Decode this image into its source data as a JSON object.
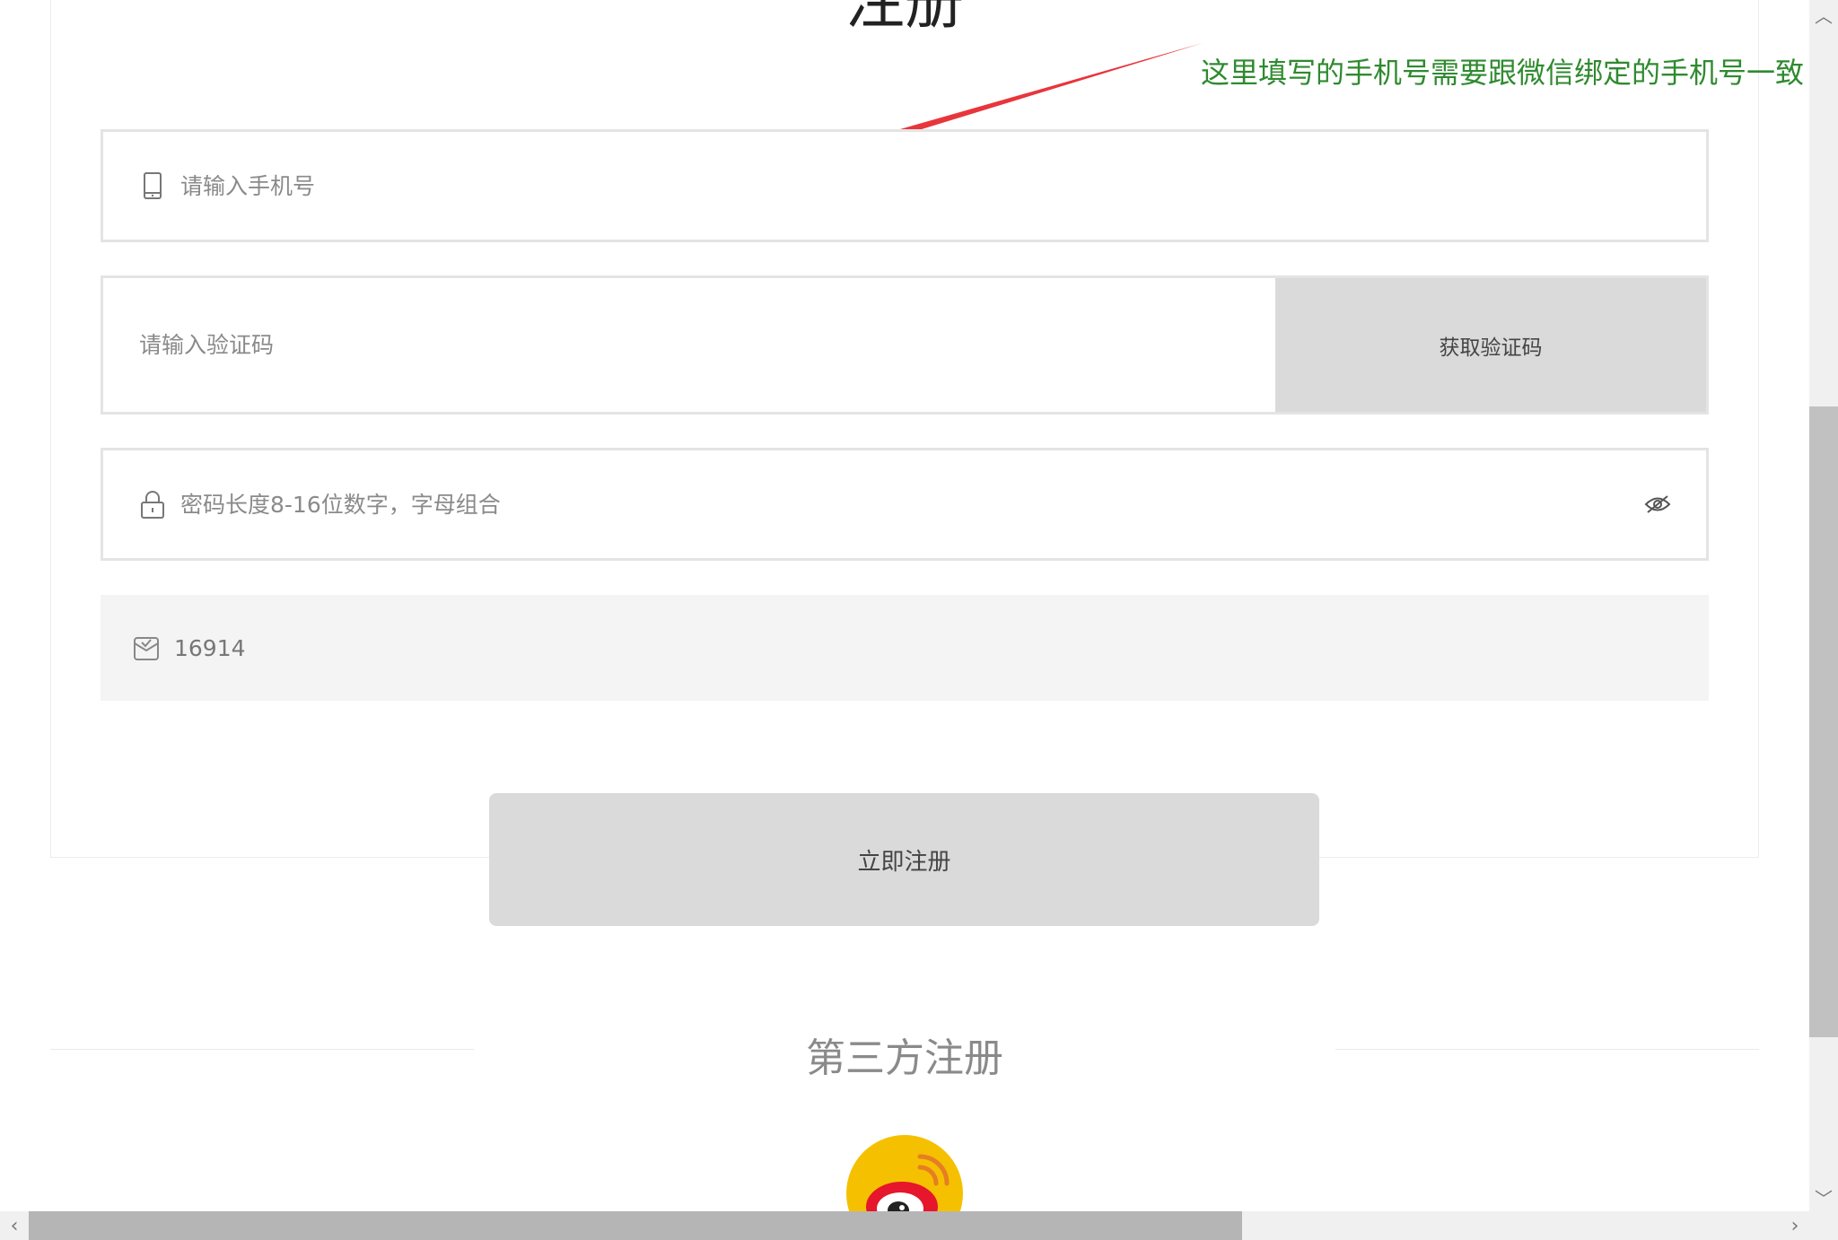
{
  "page": {
    "title": "注册"
  },
  "annotation": {
    "text": "这里填写的手机号需要跟微信绑定的手机号一致",
    "text_color": "#2f8a2f",
    "arrow_color": "#e8353b"
  },
  "form": {
    "phone": {
      "placeholder": "请输入手机号",
      "value": "",
      "icon": "mobile-phone-icon"
    },
    "code": {
      "placeholder": "请输入验证码",
      "value": "",
      "button_label": "获取验证码"
    },
    "password": {
      "placeholder": "密码长度8-16位数字，字母组合",
      "value": "",
      "icon": "lock-icon",
      "toggle_icon": "eye-hidden-icon"
    },
    "invite": {
      "value": "16914",
      "icon": "inbox-check-icon"
    },
    "submit_label": "立即注册"
  },
  "third_party": {
    "title": "第三方注册",
    "providers": [
      {
        "name": "weibo",
        "icon": "weibo-icon",
        "color": "#f5c000"
      }
    ]
  },
  "scrollbars": {
    "up_arrow": "︿",
    "down_arrow": "﹀",
    "left_arrow": "‹",
    "right_arrow": "›"
  }
}
